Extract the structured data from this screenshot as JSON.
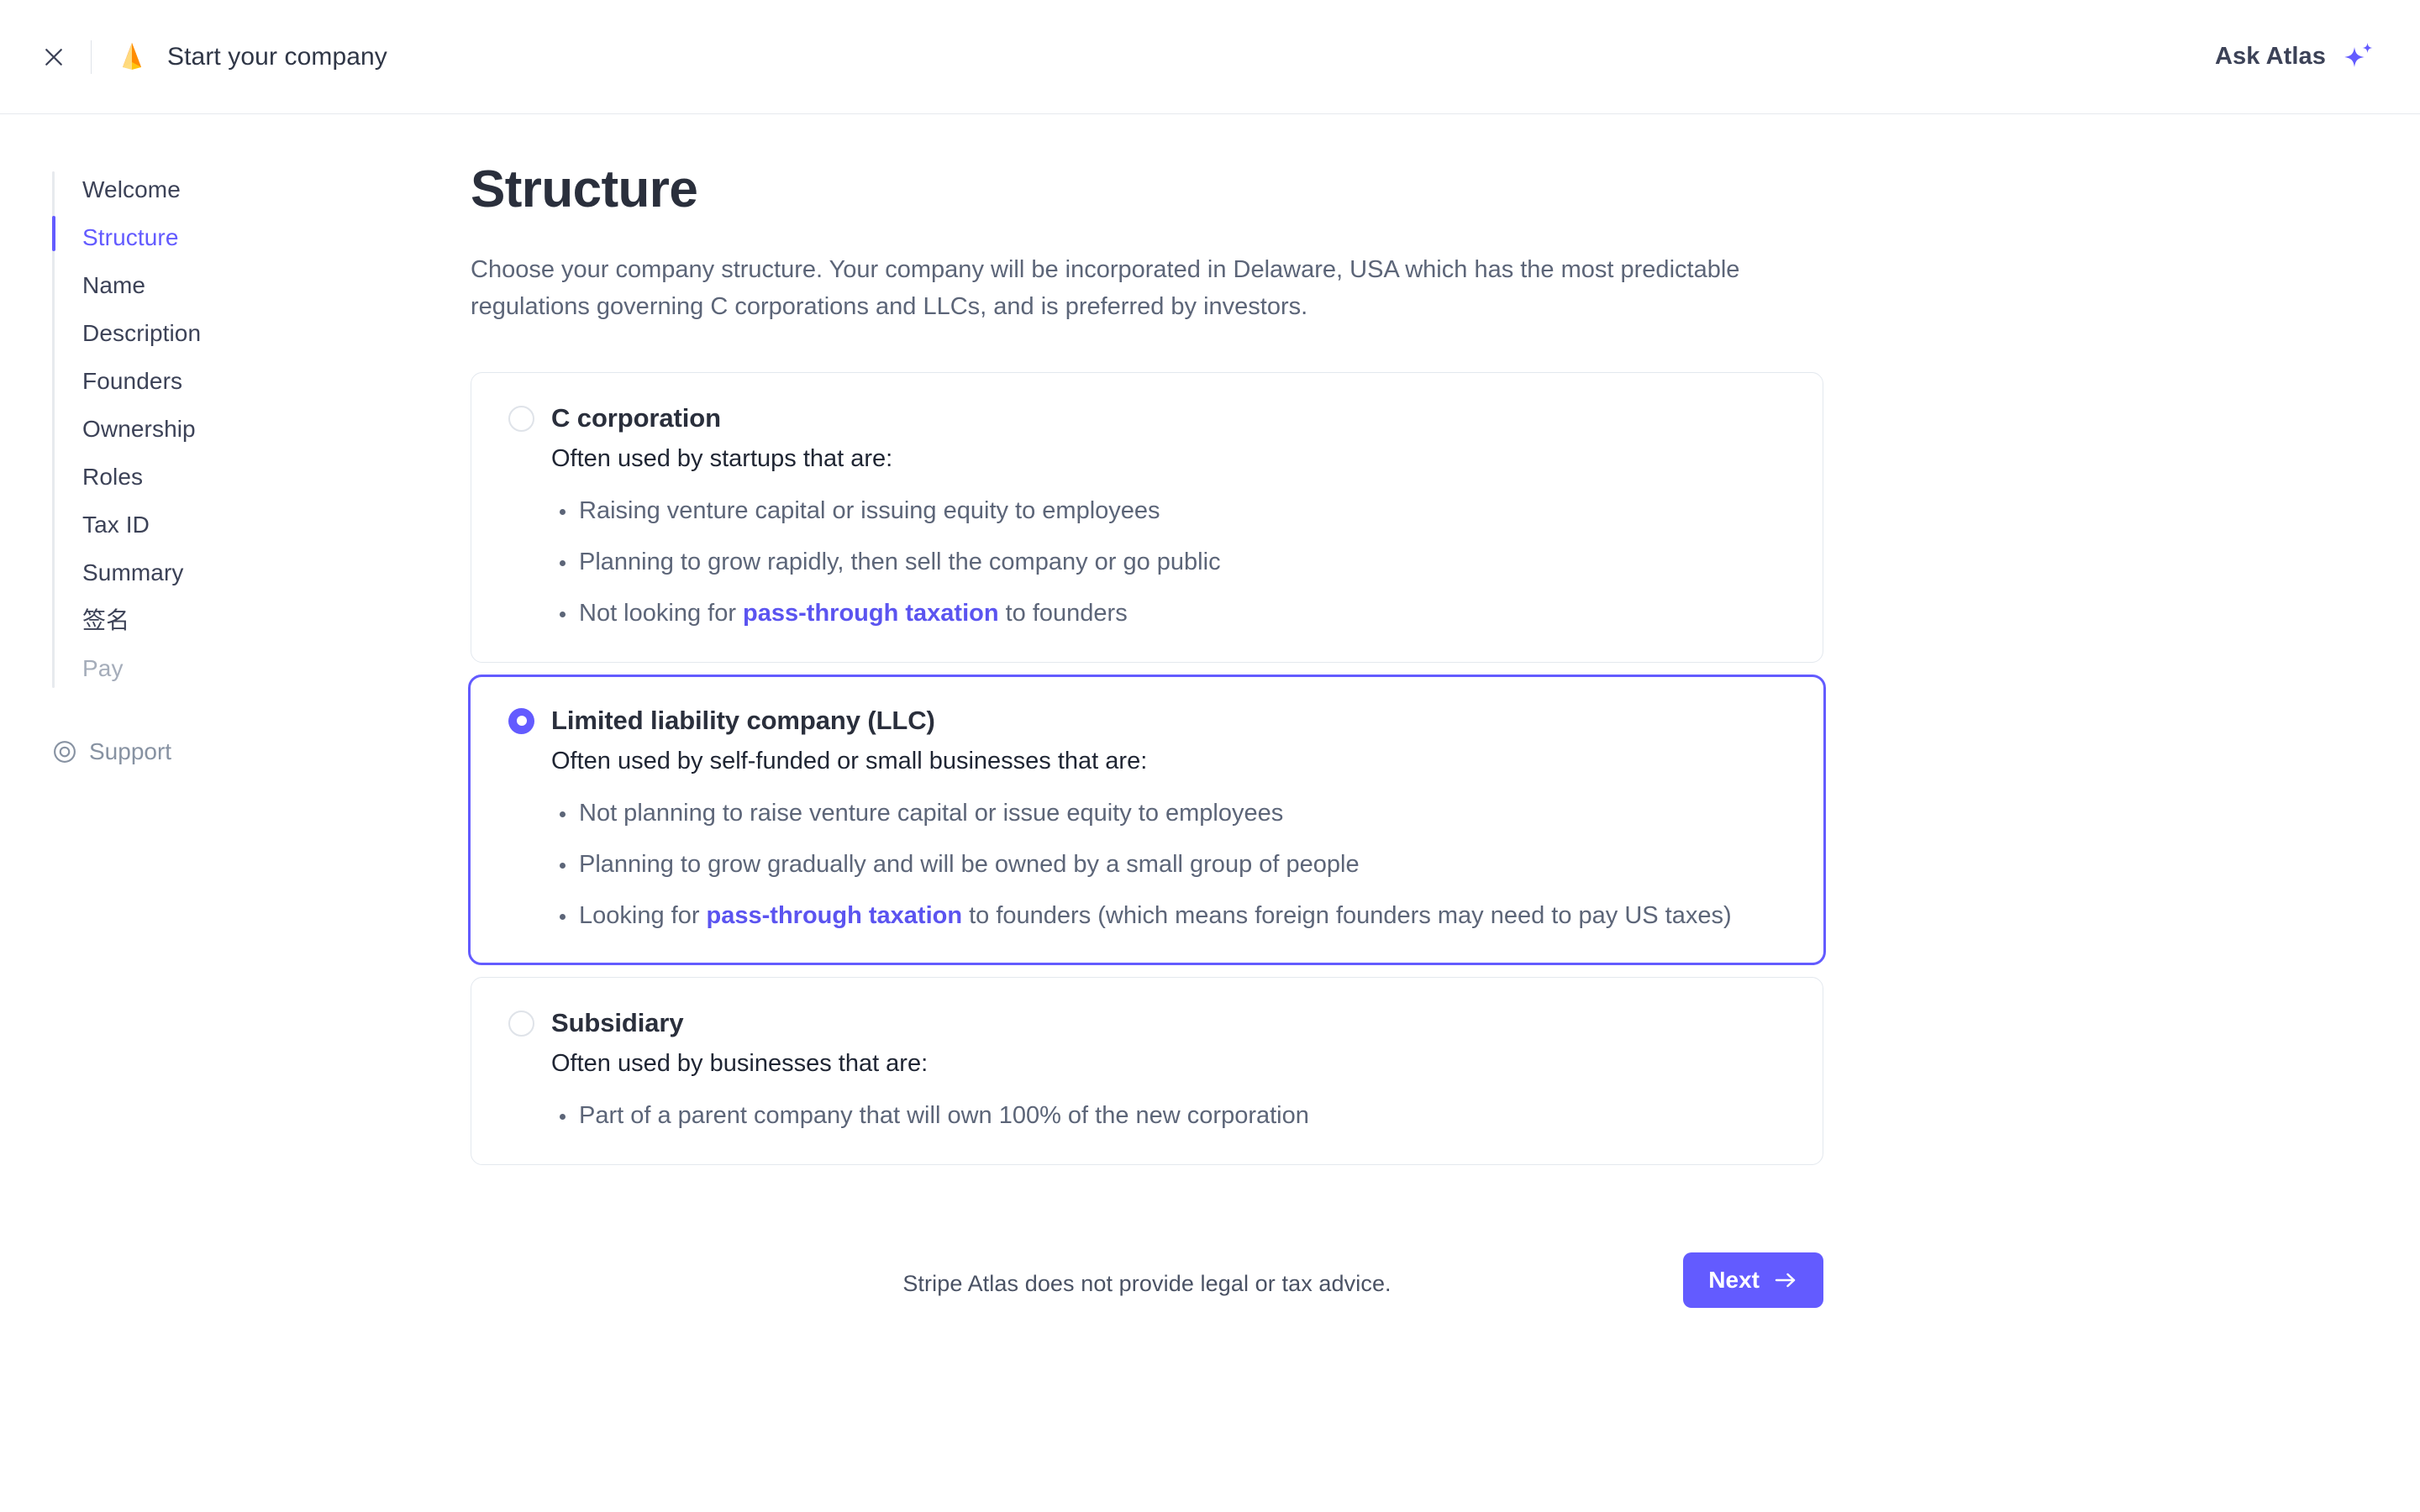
{
  "header": {
    "close_icon": "close-icon",
    "logo_icon": "atlas-logo-icon",
    "title": "Start your company",
    "ask_atlas_label": "Ask Atlas",
    "ask_atlas_icon": "sparkles-icon",
    "accent_color": "#635bff",
    "logo_colors": [
      "#ff7a00",
      "#ffd466",
      "#ffc107"
    ]
  },
  "sidebar": {
    "items": [
      {
        "label": "Welcome",
        "state": "default"
      },
      {
        "label": "Structure",
        "state": "active"
      },
      {
        "label": "Name",
        "state": "default"
      },
      {
        "label": "Description",
        "state": "default"
      },
      {
        "label": "Founders",
        "state": "default"
      },
      {
        "label": "Ownership",
        "state": "default"
      },
      {
        "label": "Roles",
        "state": "default"
      },
      {
        "label": "Tax ID",
        "state": "default"
      },
      {
        "label": "Summary",
        "state": "default"
      },
      {
        "label": "签名",
        "state": "default"
      },
      {
        "label": "Pay",
        "state": "disabled"
      }
    ],
    "support": {
      "label": "Support",
      "icon": "lifebuoy-icon"
    },
    "active_color": "#635bff",
    "disabled_color": "#a5adba"
  },
  "main": {
    "title": "Structure",
    "description": "Choose your company structure. Your company will be incorporated in Delaware, USA which has the most predictable regulations governing C corporations and LLCs, and is preferred by investors.",
    "options": [
      {
        "id": "c-corporation",
        "title": "C corporation",
        "subtitle": "Often used by startups that are:",
        "selected": false,
        "bullets": [
          {
            "pre": "Raising venture capital or issuing equity to employees",
            "link": "",
            "post": ""
          },
          {
            "pre": "Planning to grow rapidly, then sell the company or go public",
            "link": "",
            "post": ""
          },
          {
            "pre": "Not looking for ",
            "link": "pass-through taxation",
            "post": " to founders"
          }
        ]
      },
      {
        "id": "limited-liability-company",
        "title": "Limited liability company (LLC)",
        "subtitle": "Often used by self-funded or small businesses that are:",
        "selected": true,
        "bullets": [
          {
            "pre": "Not planning to raise venture capital or issue equity to employees",
            "link": "",
            "post": ""
          },
          {
            "pre": "Planning to grow gradually and will be owned by a small group of people",
            "link": "",
            "post": ""
          },
          {
            "pre": "Looking for ",
            "link": "pass-through taxation",
            "post": " to founders (which means foreign founders may need to pay US taxes)"
          }
        ]
      },
      {
        "id": "subsidiary",
        "title": "Subsidiary",
        "subtitle": "Often used by businesses that are:",
        "selected": false,
        "bullets": [
          {
            "pre": "Part of a parent company that will own 100% of the new corporation",
            "link": "",
            "post": ""
          }
        ]
      }
    ]
  },
  "footer": {
    "disclaimer": "Stripe Atlas does not provide legal or tax advice.",
    "next_label": "Next",
    "next_icon": "arrow-right-icon",
    "next_color": "#635bff"
  }
}
